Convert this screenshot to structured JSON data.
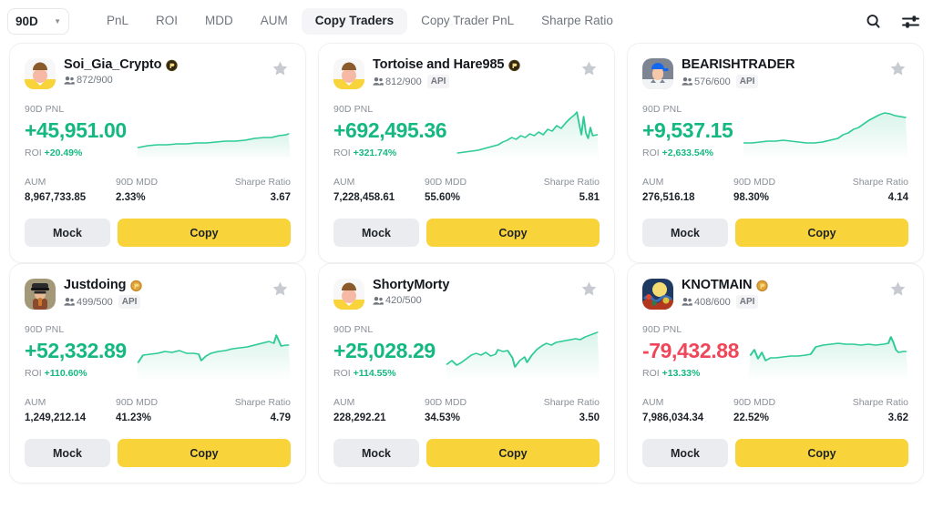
{
  "topbar": {
    "period": "90D",
    "caret_icon": "chevron-down-icon",
    "tabs": [
      {
        "label": "PnL",
        "active": false
      },
      {
        "label": "ROI",
        "active": false
      },
      {
        "label": "MDD",
        "active": false
      },
      {
        "label": "AUM",
        "active": false
      },
      {
        "label": "Copy Traders",
        "active": true
      },
      {
        "label": "Copy Trader PnL",
        "active": false
      },
      {
        "label": "Sharpe Ratio",
        "active": false
      }
    ],
    "search_icon": "search-icon",
    "filter_icon": "sliders-filter-icon"
  },
  "labels": {
    "pnl_label": "90D PNL",
    "roi_prefix": "ROI",
    "aum_label": "AUM",
    "mdd_label": "90D MDD",
    "sharpe_label": "Sharpe Ratio",
    "mock_button": "Mock",
    "copy_button": "Copy",
    "api_tag": "API",
    "star_icon": "favorite-star-icon",
    "followers_icon": "followers-people-icon"
  },
  "colors": {
    "positive": "#15b881",
    "negative": "#f0465a",
    "accent_yellow": "#f8d33a",
    "muted": "#8a8f98"
  },
  "cards": [
    {
      "name": "Soi_Gia_Crypto",
      "badge_icon": "gold-medal-icon",
      "avatar_icon": "avatar-yellow-person",
      "followers": "872/900",
      "api": false,
      "pnl": "+45,951.00",
      "pnl_sign": "pos",
      "roi": "+20.49%",
      "roi_sign": "pos",
      "aum": "8,967,733.85",
      "mdd": "2.33%",
      "sharpe": "3.67",
      "spark": "2,44 10,42 18,41 26,41 34,40 42,40 50,39 58,39 66,38 74,37 82,37 90,36 98,34 106,33 112,33 118,31 124,30 126,29"
    },
    {
      "name": "Tortoise and Hare985",
      "badge_icon": "gold-medal-icon",
      "avatar_icon": "avatar-yellow-person",
      "followers": "812/900",
      "api": true,
      "pnl": "+692,495.36",
      "pnl_sign": "pos",
      "roi": "+321.74%",
      "roi_sign": "pos",
      "aum": "7,228,458.61",
      "mdd": "55.60%",
      "sharpe": "5.81",
      "spark": "2,50 8,49 14,48 20,47 26,45 32,43 38,41 42,38 46,36 50,33 54,35 58,31 62,33 66,29 70,31 74,27 78,30 82,24 86,26 90,20 94,23 98,17 102,12 106,8 108,5 110,18 112,30 114,10 116,28 118,34 120,22 122,31 126,30"
    },
    {
      "name": "BEARISHTRADER",
      "badge_icon": "none",
      "avatar_icon": "avatar-blue-cap-person",
      "followers": "576/600",
      "api": true,
      "pnl": "+9,537.15",
      "pnl_sign": "pos",
      "roi": "+2,633.54%",
      "roi_sign": "pos",
      "aum": "276,516.18",
      "mdd": "98.30%",
      "sharpe": "4.14",
      "spark": "2,39 8,39 14,38 20,37 26,37 32,36 38,37 44,38 50,39 56,39 62,38 68,36 74,34 78,30 82,28 86,24 90,22 94,18 98,14 102,11 106,8 110,6 114,7 118,9 122,10 126,11"
    },
    {
      "name": "Justdoing",
      "badge_icon": "bronze-medal-icon",
      "avatar_icon": "avatar-police-person",
      "followers": "499/500",
      "api": true,
      "pnl": "+52,332.89",
      "pnl_sign": "pos",
      "roi": "+110.60%",
      "roi_sign": "pos",
      "aum": "1,249,212.14",
      "mdd": "41.23%",
      "sharpe": "4.79",
      "spark": "2,38 6,30 12,29 18,28 24,26 30,27 36,25 42,28 48,28 52,29 54,36 58,31 62,28 68,26 74,25 80,23 86,22 92,21 98,19 104,17 110,15 114,17 116,8 118,14 120,20 124,19 126,19"
    },
    {
      "name": "ShortyMorty",
      "badge_icon": "none",
      "avatar_icon": "avatar-yellow-person",
      "followers": "420/500",
      "api": false,
      "pnl": "+25,028.29",
      "pnl_sign": "pos",
      "roi": "+114.55%",
      "roi_sign": "pos",
      "aum": "228,292.21",
      "mdd": "34.53%",
      "sharpe": "3.50",
      "spark": "2,40 6,36 10,41 14,38 18,34 22,30 26,28 30,30 34,27 38,31 42,29 44,24 48,26 52,25 56,33 58,43 62,36 66,32 68,38 72,30 76,24 80,20 84,17 88,19 92,16 96,15 100,14 104,13 108,12 112,13 116,10 120,8 124,6 126,5"
    },
    {
      "name": "KNOTMAIN",
      "badge_icon": "bronze-medal-icon",
      "avatar_icon": "avatar-globe-art",
      "followers": "408/600",
      "api": true,
      "pnl": "-79,432.88",
      "pnl_sign": "neg",
      "roi": "+13.33%",
      "roi_sign": "pos",
      "aum": "7,986,034.34",
      "mdd": "22.52%",
      "sharpe": "3.62",
      "spark": "2,30 5,24 8,34 11,27 14,36 18,33 22,33 28,32 34,31 40,31 46,30 50,29 54,21 60,19 66,18 72,17 78,18 84,18 90,19 96,18 102,19 108,18 112,17 114,10 116,16 118,24 120,27 124,26 126,26"
    }
  ]
}
